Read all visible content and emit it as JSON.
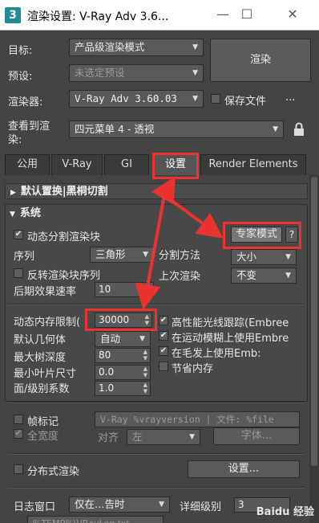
{
  "window": {
    "title": "渲染设置: V-Ray Adv 3.6...",
    "min": "—",
    "max": "☐",
    "close": "✕",
    "logo": "3"
  },
  "top": {
    "target_label": "目标:",
    "target_value": "产品级渲染模式",
    "preset_label": "预设:",
    "preset_value": "未选定预设",
    "renderer_label": "渲染器:",
    "renderer_value": "V-Ray Adv 3.60.03",
    "save_file_label": "保存文件",
    "more": "...",
    "view_label_1": "查看到渲",
    "view_label_2": "染:",
    "view_value": "四元菜单 4 - 透视",
    "render_button": "渲染"
  },
  "tabs": [
    "公用",
    "V-Ray",
    "GI",
    "设置",
    "Render Elements"
  ],
  "rollouts": {
    "default_replace": "默认置换|黑桐切割",
    "system": "系统"
  },
  "system": {
    "dynamic_split": "动态分割渲染块",
    "expert_mode": "专家模式",
    "help": "?",
    "sequence_label": "序列",
    "sequence_value": "三角形",
    "split_method_label": "分割方法",
    "split_method_value": "大小",
    "reverse_seq": "反转渲染块序列",
    "last_render_label": "上次渲染",
    "last_render_value": "不变",
    "post_rate_label": "后期效果速率",
    "post_rate_value": "10",
    "dyn_mem_label": "动态内存限制(",
    "dyn_mem_value": "30000",
    "default_geom_label": "默认几何体",
    "default_geom_value": "自动",
    "max_tree_label": "最大树深度",
    "max_tree_value": "80",
    "min_leaf_label": "最小叶片尺寸",
    "min_leaf_value": "0.0",
    "face_level_label": "面/级别系数",
    "face_level_value": "1.0",
    "hp_raytrace": "高性能光线跟踪(Embree",
    "motion_blur": "在运动模糊上使用Embre",
    "hair": "在毛发上使用Emb:",
    "save_mem": "节省内存"
  },
  "stamp": {
    "frame_stamp": "帧标记",
    "frame_text": "V-Ray %vrayversion | 文件: %file",
    "full_width": "全宽度",
    "align_label": "对齐",
    "align_value": "左",
    "font_button": "字体..."
  },
  "distributed": {
    "label": "分布式渲染",
    "settings_button": "设置..."
  },
  "log": {
    "label": "日志窗口",
    "value": "仅在…告时",
    "detail_label": "详细级别",
    "detail_value": "3",
    "path": "%TEMP%\\VRayLog.txt"
  },
  "watermark": "Baidu 经验"
}
